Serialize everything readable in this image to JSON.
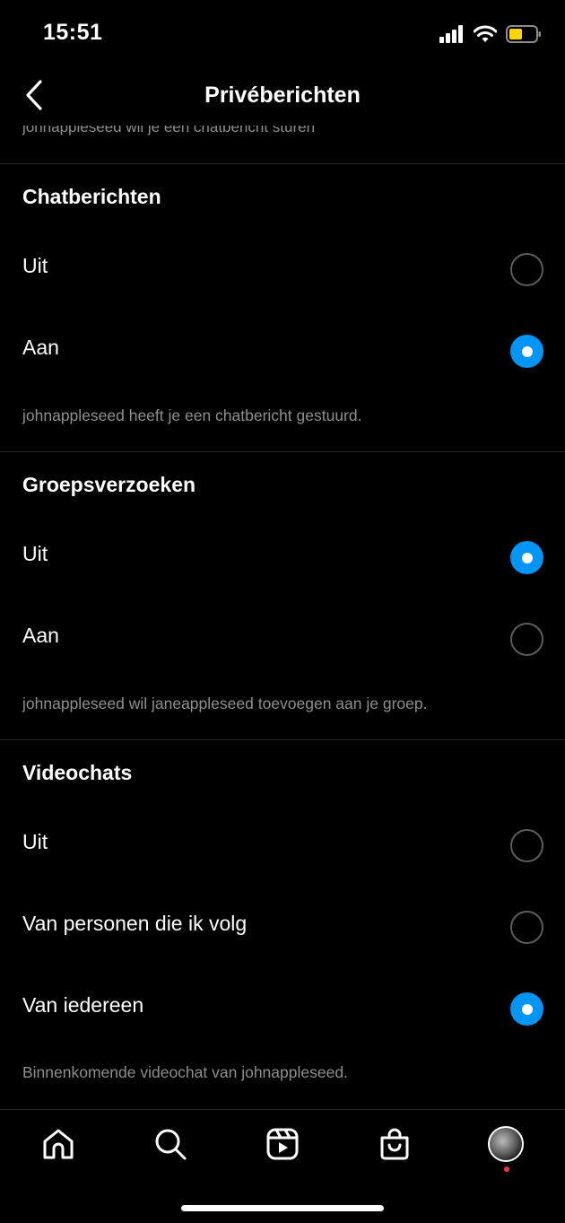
{
  "status_bar": {
    "time": "15:51"
  },
  "header": {
    "title": "Privéberichten"
  },
  "partial_description": "johnappleseed wil je een chatbericht sturen",
  "sections": [
    {
      "title": "Chatberichten",
      "options": [
        {
          "label": "Uit",
          "selected": false
        },
        {
          "label": "Aan",
          "selected": true
        }
      ],
      "description": "johnappleseed heeft je een chatbericht gestuurd."
    },
    {
      "title": "Groepsverzoeken",
      "options": [
        {
          "label": "Uit",
          "selected": true
        },
        {
          "label": "Aan",
          "selected": false
        }
      ],
      "description": "johnappleseed wil janeappleseed toevoegen aan je groep."
    },
    {
      "title": "Videochats",
      "options": [
        {
          "label": "Uit",
          "selected": false
        },
        {
          "label": "Van personen die ik volg",
          "selected": false
        },
        {
          "label": "Van iedereen",
          "selected": true
        }
      ],
      "description": "Binnenkomende videochat van johnappleseed."
    }
  ],
  "tab_bar": {
    "tabs": [
      "home-icon",
      "search-icon",
      "reels-icon",
      "shop-icon",
      "profile-avatar"
    ],
    "notification_dot": true
  },
  "colors": {
    "accent": "#0095f6",
    "background": "#000000",
    "secondary_text": "#8e8e8e",
    "notification": "#ff3040"
  }
}
